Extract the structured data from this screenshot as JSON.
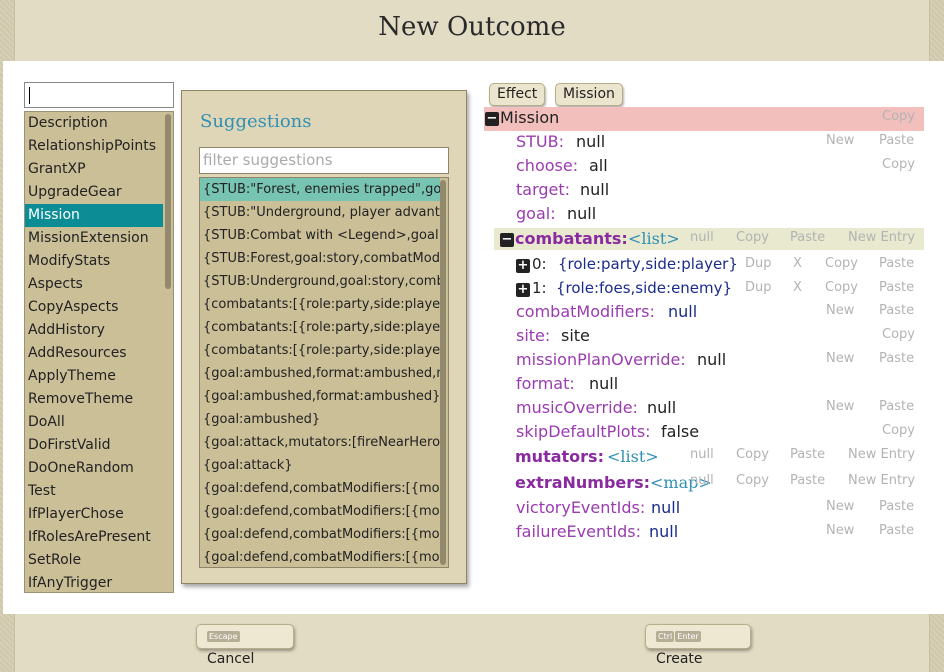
{
  "dialog": {
    "title": "New Outcome"
  },
  "left": {
    "search_value": "",
    "items": [
      "Description",
      "RelationshipPoints",
      "GrantXP",
      "UpgradeGear",
      "Mission",
      "MissionExtension",
      "ModifyStats",
      "Aspects",
      "CopyAspects",
      "AddHistory",
      "AddResources",
      "ApplyTheme",
      "RemoveTheme",
      "DoAll",
      "DoFirstValid",
      "DoOneRandom",
      "Test",
      "IfPlayerChose",
      "IfRolesArePresent",
      "SetRole",
      "IfAnyTrigger"
    ],
    "selected": "Mission"
  },
  "suggestions": {
    "title": "Suggestions",
    "filter_placeholder": "filter suggestions",
    "items": [
      "{STUB:\"Forest, enemies trapped\",goal:story,combat",
      "{STUB:\"Underground, player advantage\",goal:story",
      "{STUB:Combat with <Legend>,goal:story,combatMo",
      "{STUB:Forest,goal:story,combatModifiers:[{mod",
      "{STUB:Underground,goal:story,combatModifiers:",
      "{combatants:[{role:party,side:player},{role:fo",
      "{combatants:[{role:party,side:player},{role:fo",
      "{combatants:[{role:party,side:player},{role:fo",
      "{goal:ambushed,format:ambushed,mutators:[",
      "{goal:ambushed,format:ambushed}",
      "{goal:ambushed}",
      "{goal:attack,mutators:[fireNearHeroes]}",
      "{goal:attack}",
      "{goal:defend,combatModifiers:[{modifier:",
      "{goal:defend,combatModifiers:[{modifier:",
      "{goal:defend,combatModifiers:[{modifier:",
      "{goal:defend,combatModifiers:[{modifier:"
    ]
  },
  "editor": {
    "tabs": [
      "Effect",
      "Mission"
    ],
    "root_label": "Mission",
    "buttons": {
      "copy": "Copy",
      "new": "New",
      "paste": "Paste",
      "null": "null",
      "new_entry": "New Entry",
      "dup": "Dup",
      "x": "X"
    },
    "fields": {
      "stub": {
        "key": "STUB:",
        "value": "null"
      },
      "choose": {
        "key": "choose:",
        "value": "all"
      },
      "target": {
        "key": "target:",
        "value": "null"
      },
      "goal": {
        "key": "goal:",
        "value": "null"
      },
      "combatants": {
        "key": "combatants:",
        "value": "<list>"
      },
      "comb0": {
        "key": "0:",
        "value": "{role:party,side:player}"
      },
      "comb1": {
        "key": "1:",
        "value": "{role:foes,side:enemy}"
      },
      "combatModifiers": {
        "key": "combatModifiers:",
        "value": "null"
      },
      "site": {
        "key": "site:",
        "value": "site"
      },
      "missionPlanOverride": {
        "key": "missionPlanOverride:",
        "value": "null"
      },
      "format": {
        "key": "format:",
        "value": "null"
      },
      "musicOverride": {
        "key": "musicOverride:",
        "value": "null"
      },
      "skipDefaultPlots": {
        "key": "skipDefaultPlots:",
        "value": "false"
      },
      "mutators": {
        "key": "mutators:",
        "value": "<list>"
      },
      "extraNumbers": {
        "key": "extraNumbers:",
        "value": "<map>"
      },
      "victoryEventIds": {
        "key": "victoryEventIds:",
        "value": "null"
      },
      "failureEventIds": {
        "key": "failureEventIds:",
        "value": "null"
      }
    }
  },
  "footer": {
    "cancel_label": "Cancel",
    "cancel_key": "Escape",
    "create_label": "Create",
    "create_keys": [
      "Ctrl",
      "Enter"
    ]
  },
  "colors": {
    "selection": "#0c8d95",
    "suggestion_selected": "#78c4b3",
    "key_text": "#9b3bb0",
    "type_text": "#2f8fb4",
    "mission_row_bg": "#f2bfbd"
  }
}
